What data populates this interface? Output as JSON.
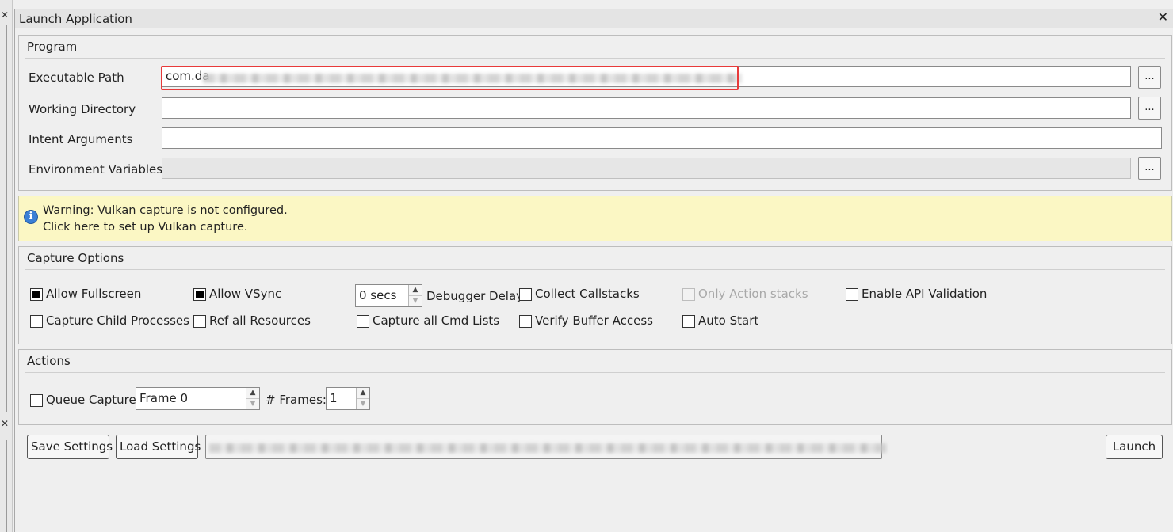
{
  "window": {
    "title": "Launch Application",
    "close_glyph": "✕"
  },
  "program": {
    "title": "Program",
    "executable_path": {
      "label": "Executable Path",
      "value": "com.da"
    },
    "working_directory": {
      "label": "Working Directory",
      "value": ""
    },
    "intent_arguments": {
      "label": "Intent Arguments",
      "value": ""
    },
    "environment_variables": {
      "label": "Environment Variables",
      "value": ""
    },
    "browse_label": "..."
  },
  "warning": {
    "line1": "Warning: Vulkan capture is not configured.",
    "line2": "Click here to set up Vulkan capture.",
    "icon": "info-icon"
  },
  "capture_options": {
    "title": "Capture Options",
    "allow_fullscreen": {
      "label": "Allow Fullscreen",
      "checked": true
    },
    "allow_vsync": {
      "label": "Allow VSync",
      "checked": true
    },
    "debugger_delay": {
      "value": "0 secs",
      "label": "Debugger Delay"
    },
    "collect_callstacks": {
      "label": "Collect Callstacks",
      "checked": false
    },
    "only_action_stacks": {
      "label": "Only Action stacks",
      "checked": false,
      "disabled": true
    },
    "enable_api_validation": {
      "label": "Enable API Validation",
      "checked": false
    },
    "capture_child_processes": {
      "label": "Capture Child Processes",
      "checked": false
    },
    "ref_all_resources": {
      "label": "Ref all Resources",
      "checked": false
    },
    "capture_all_cmd_lists": {
      "label": "Capture all Cmd Lists",
      "checked": false
    },
    "verify_buffer_access": {
      "label": "Verify Buffer Access",
      "checked": false
    },
    "auto_start": {
      "label": "Auto Start",
      "checked": false
    }
  },
  "actions": {
    "title": "Actions",
    "queue_capture": {
      "label": "Queue Capture",
      "checked": false
    },
    "frame": {
      "value": "Frame 0"
    },
    "frames": {
      "label": "# Frames:",
      "value": "1"
    }
  },
  "buttons": {
    "save_settings": "Save Settings",
    "load_settings": "Load Settings",
    "launch": "Launch"
  },
  "spin_up": "▲",
  "spin_down": "▼"
}
